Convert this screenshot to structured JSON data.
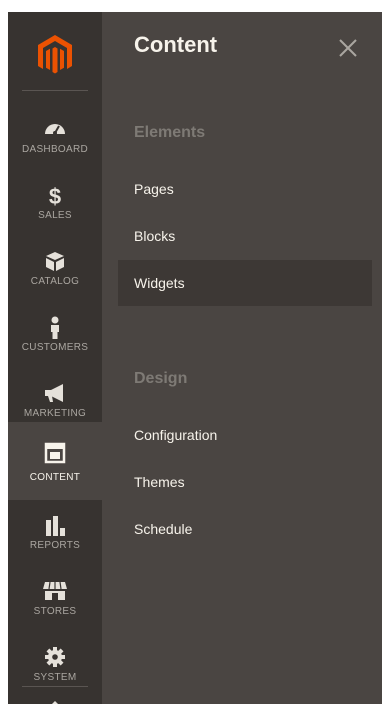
{
  "sidebar": {
    "logo": "magento-logo-icon",
    "items": [
      {
        "label": "DASHBOARD",
        "icon": "dashboard-gauge-icon",
        "active": false
      },
      {
        "label": "SALES",
        "icon": "dollar-icon",
        "active": false
      },
      {
        "label": "CATALOG",
        "icon": "box-icon",
        "active": false
      },
      {
        "label": "CUSTOMERS",
        "icon": "person-icon",
        "active": false
      },
      {
        "label": "MARKETING",
        "icon": "megaphone-icon",
        "active": false
      },
      {
        "label": "CONTENT",
        "icon": "layout-icon",
        "active": true
      },
      {
        "label": "REPORTS",
        "icon": "bar-chart-icon",
        "active": false
      },
      {
        "label": "STORES",
        "icon": "storefront-icon",
        "active": false
      },
      {
        "label": "SYSTEM",
        "icon": "gear-icon",
        "active": false
      }
    ]
  },
  "panel": {
    "title": "Content",
    "close_icon": "close-icon",
    "sections": [
      {
        "title": "Elements",
        "links": [
          "Pages",
          "Blocks",
          "Widgets"
        ]
      },
      {
        "title": "Design",
        "links": [
          "Configuration",
          "Themes",
          "Schedule"
        ]
      }
    ],
    "highlighted_link": "Widgets"
  },
  "colors": {
    "brand_orange": "#eb5202",
    "sidebar_bg": "#373330",
    "panel_bg": "#4a4542",
    "text_light": "#f7f3eb",
    "text_muted": "#aaa6a0",
    "section_title": "#7e7a75"
  }
}
